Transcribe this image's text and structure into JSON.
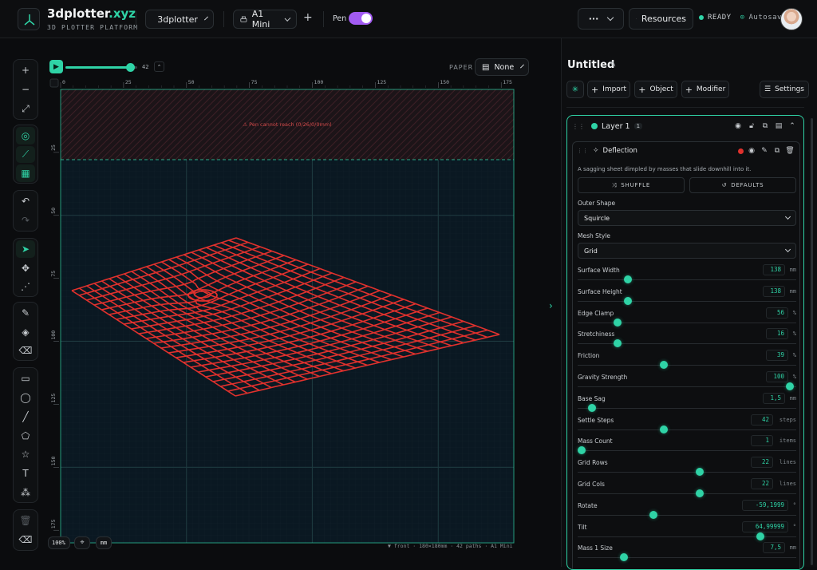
{
  "app": {
    "brand_main": "3dplotter",
    "brand_tld": ".xyz",
    "subtitle": "3D PLOTTER PLATFORM",
    "project_select": "3dplotter",
    "machine_select": "A1 Mini",
    "pen_label": "Pen",
    "pen_enabled": true,
    "more_label": "···",
    "resources_label": "Resources",
    "status_ready": "READY",
    "status_saved": "Autosaved"
  },
  "canvas": {
    "playback_value": "42",
    "playback_fraction": 0.9,
    "paper_label": "PAPER",
    "paper_value": "None",
    "ruler_top": [
      "0",
      "25",
      "50",
      "75",
      "100",
      "125",
      "150",
      "175"
    ],
    "ruler_left": [
      "25",
      "50",
      "75",
      "100",
      "125",
      "150",
      "175"
    ],
    "warning": "⚠ Pen cannot reach (0/26/0/0mm)",
    "zoom": "100%",
    "units": "mm",
    "footer": "▼ front · 180×180mm · 42 paths · A1 Mini"
  },
  "panel": {
    "title": "Untitled",
    "import_label": "Import",
    "object_label": "Object",
    "modifier_label": "Modifier",
    "settings_label": "Settings",
    "layer": {
      "name": "Layer 1",
      "count": "1"
    },
    "modifier": {
      "name": "Deflection",
      "description": "A sagging sheet dimpled by masses that slide downhill into it.",
      "shuffle_label": "SHUFFLE",
      "defaults_label": "DEFAULTS",
      "outer_shape_label": "Outer Shape",
      "outer_shape_value": "Squircle",
      "mesh_style_label": "Mesh Style",
      "mesh_style_value": "Grid"
    },
    "params": [
      {
        "label": "Surface Width",
        "value": "138",
        "unit": "mm",
        "fraction": 0.22
      },
      {
        "label": "Surface Height",
        "value": "138",
        "unit": "mm",
        "fraction": 0.22
      },
      {
        "label": "Edge Clamp",
        "value": "56",
        "unit": "%",
        "fraction": 0.17
      },
      {
        "label": "Stretchiness",
        "value": "16",
        "unit": "%",
        "fraction": 0.17
      },
      {
        "label": "Friction",
        "value": "39",
        "unit": "%",
        "fraction": 0.39
      },
      {
        "label": "Gravity Strength",
        "value": "100",
        "unit": "%",
        "fraction": 0.99
      },
      {
        "label": "Base Sag",
        "value": "1,5",
        "unit": "mm",
        "fraction": 0.05
      },
      {
        "label": "Settle Steps",
        "value": "42",
        "unit": "steps",
        "fraction": 0.39
      },
      {
        "label": "Mass Count",
        "value": "1",
        "unit": "items",
        "fraction": 0.0
      },
      {
        "label": "Grid Rows",
        "value": "22",
        "unit": "lines",
        "fraction": 0.56
      },
      {
        "label": "Grid Cols",
        "value": "22",
        "unit": "lines",
        "fraction": 0.56
      },
      {
        "label": "Rotate",
        "value": "-59,1999",
        "unit": "°",
        "fraction": 0.34
      },
      {
        "label": "Tilt",
        "value": "64,99999",
        "unit": "°",
        "fraction": 0.85
      },
      {
        "label": "Mass 1 Size",
        "value": "7,5",
        "unit": "mm",
        "fraction": 0.2
      }
    ]
  },
  "colors": {
    "accent": "#2fd3a6",
    "plot": "#e0312d",
    "toggle": "#a25bf2"
  }
}
